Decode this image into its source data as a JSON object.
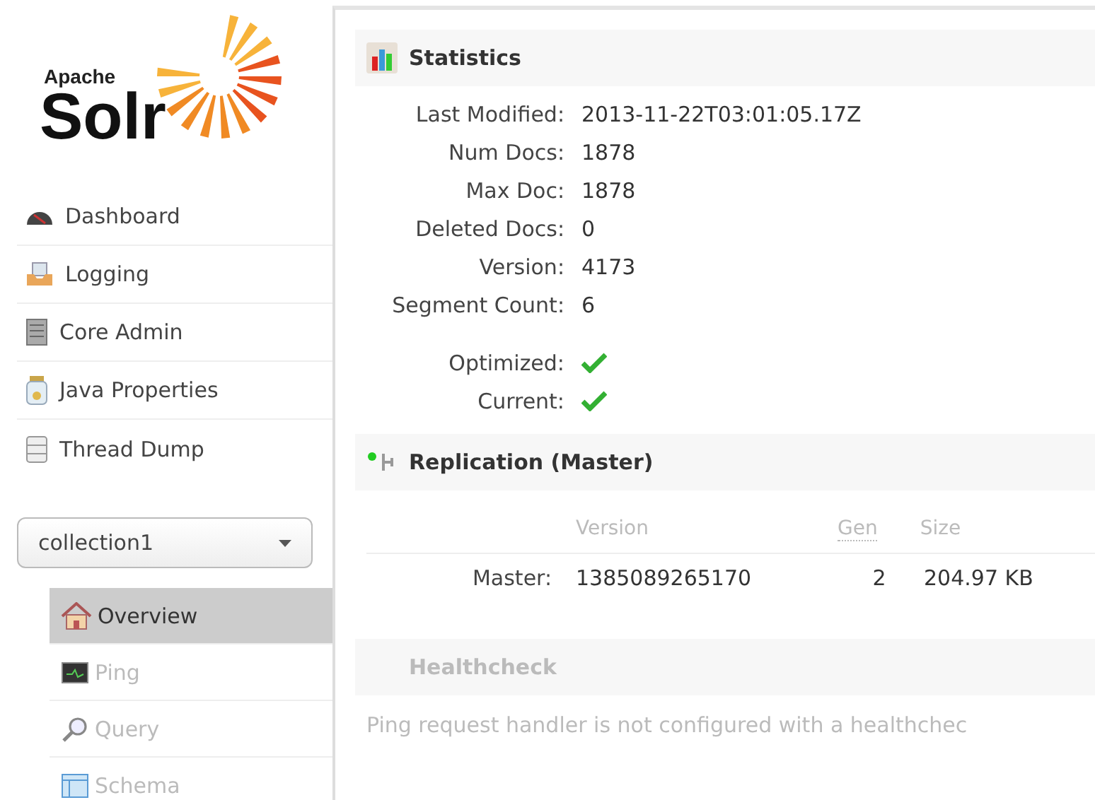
{
  "logo": {
    "small": "Apache",
    "big": "Solr"
  },
  "nav": [
    {
      "label": "Dashboard"
    },
    {
      "label": "Logging"
    },
    {
      "label": "Core Admin"
    },
    {
      "label": "Java Properties"
    },
    {
      "label": "Thread Dump"
    }
  ],
  "core_select": {
    "value": "collection1"
  },
  "core_nav": [
    {
      "label": "Overview",
      "selected": true,
      "disabled": false
    },
    {
      "label": "Ping",
      "selected": false,
      "disabled": true
    },
    {
      "label": "Query",
      "selected": false,
      "disabled": true
    },
    {
      "label": "Schema",
      "selected": false,
      "disabled": true
    }
  ],
  "statistics": {
    "title": "Statistics",
    "rows": [
      {
        "kind": "text",
        "label": "Last Modified:",
        "value": "2013-11-22T03:01:05.17Z"
      },
      {
        "kind": "text",
        "label": "Num Docs:",
        "value": "1878"
      },
      {
        "kind": "text",
        "label": "Max Doc:",
        "value": "1878"
      },
      {
        "kind": "text",
        "label": "Deleted Docs:",
        "value": "0"
      },
      {
        "kind": "text",
        "label": "Version:",
        "value": "4173"
      },
      {
        "kind": "text",
        "label": "Segment Count:",
        "value": "6"
      },
      {
        "kind": "check",
        "label": "Optimized:",
        "checked": true
      },
      {
        "kind": "check",
        "label": "Current:",
        "checked": true
      }
    ]
  },
  "replication": {
    "title": "Replication (Master)",
    "columns": [
      "Version",
      "Gen",
      "Size"
    ],
    "rows": [
      {
        "label": "Master:",
        "cells": [
          "1385089265170",
          "2",
          "204.97 KB"
        ]
      }
    ]
  },
  "healthcheck": {
    "title": "Healthcheck",
    "message": "Ping request handler is not configured with a healthchec"
  }
}
